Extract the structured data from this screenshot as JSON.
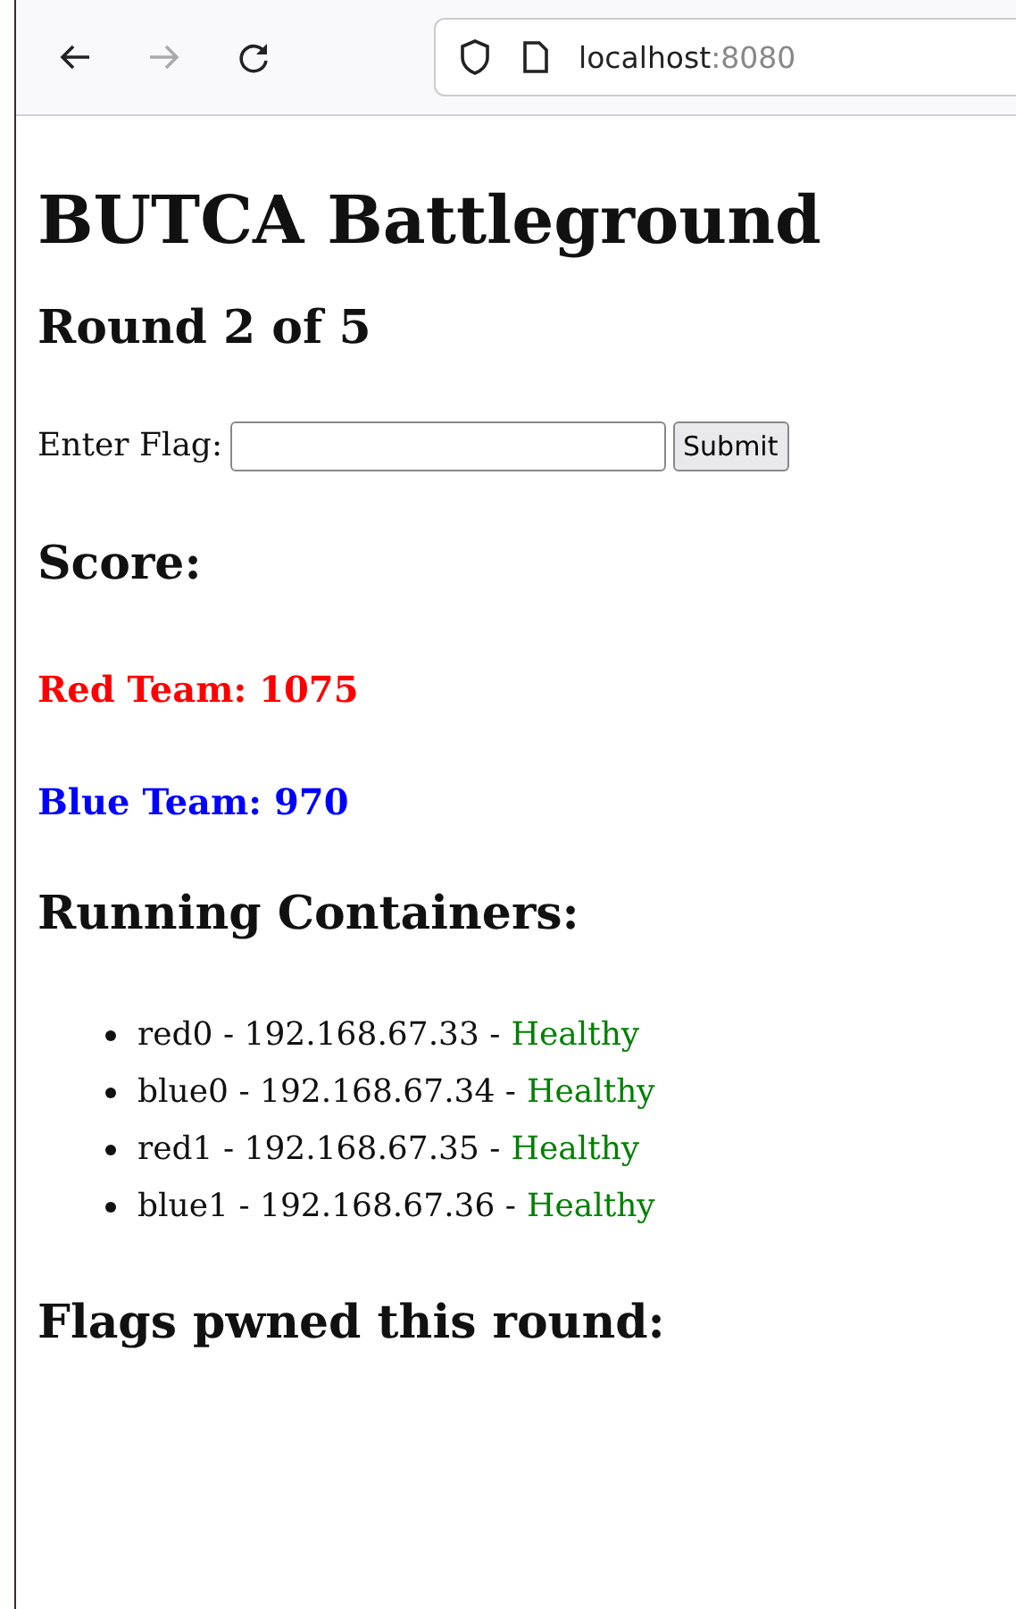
{
  "browser": {
    "nav_buttons": [
      {
        "kind": "back",
        "disabled": false
      },
      {
        "kind": "forward",
        "disabled": true
      },
      {
        "kind": "reload",
        "disabled": false
      }
    ],
    "address": {
      "host": "localhost",
      "port": ":8080"
    }
  },
  "page": {
    "title": "BUTCA Battleground",
    "round": "Round 2 of 5",
    "flag_form": {
      "label": "Enter Flag:",
      "button": "Submit"
    },
    "score_heading": "Score:",
    "teams": [
      {
        "text": "Red Team: 1075",
        "color": "#ff0000"
      },
      {
        "text": "Blue Team: 970",
        "color": "#0000ff"
      }
    ],
    "containers_heading": "Running Containers:",
    "containers": [
      {
        "label": "red0 - 192.168.67.33 -",
        "status": "Healthy",
        "color": "#008000"
      },
      {
        "label": "blue0 - 192.168.67.34 -",
        "status": "Healthy",
        "color": "#008000"
      },
      {
        "label": "red1 - 192.168.67.35 -",
        "status": "Healthy",
        "color": "#008000"
      },
      {
        "label": "blue1 - 192.168.67.36 -",
        "status": "Healthy",
        "color": "#008000"
      }
    ],
    "flags_heading": "Flags pwned this round:"
  }
}
